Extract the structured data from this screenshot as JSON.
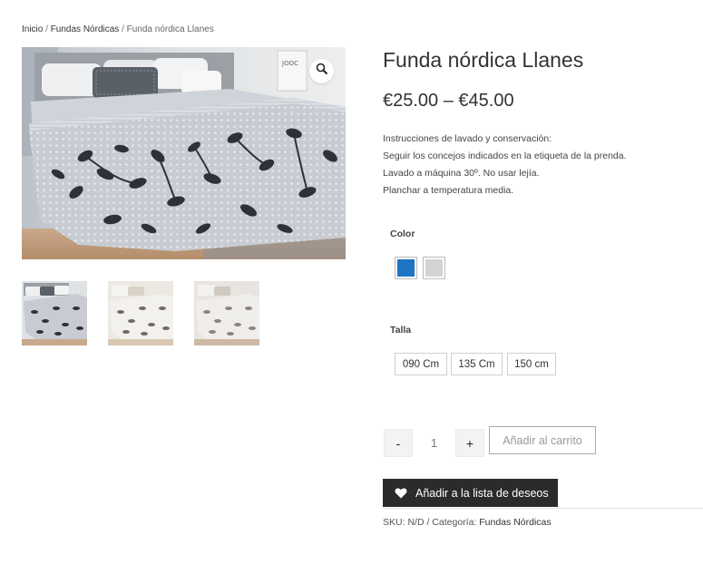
{
  "breadcrumb": {
    "home": "Inicio",
    "separator": "/",
    "category": "Fundas Nórdicas",
    "current": "Funda nórdica Llanes"
  },
  "product": {
    "title": "Funda nórdica Llanes",
    "price": "€25.00 – €45.00",
    "description": [
      "Instrucciones de lavado y conservación:",
      "Seguir los concejos indicados en la etiqueta de la prenda.",
      "Lavado a máquina 30º. No usar lejía.",
      "Planchar a temperatura media."
    ]
  },
  "gallery": {
    "zoom_icon": "magnifier-icon",
    "thumbnails": [
      "thumbnail-grey-leaves",
      "thumbnail-beige-leaves",
      "thumbnail-light-leaves"
    ]
  },
  "attributes": {
    "color": {
      "label": "Color",
      "swatches": [
        {
          "name": "blue",
          "hex": "#1f74c5"
        },
        {
          "name": "grey",
          "hex": "#d3d3d3"
        }
      ]
    },
    "size": {
      "label": "Talla",
      "options": [
        "090 Cm",
        "135 Cm",
        "150 cm"
      ]
    }
  },
  "purchase": {
    "minus": "-",
    "quantity": "1",
    "plus": "+",
    "add_to_cart": "Añadir al carrito",
    "wishlist": "Añadir a la lista de deseos",
    "wishlist_icon": "heart-icon"
  },
  "meta": {
    "sku_label": "SKU:",
    "sku": "N/D",
    "separator": "/",
    "category_label": "Categoría:",
    "category": "Fundas Nórdicas"
  },
  "colors": {
    "dark_button": "#2b2b2b",
    "accent_blue": "#1f74c5"
  }
}
